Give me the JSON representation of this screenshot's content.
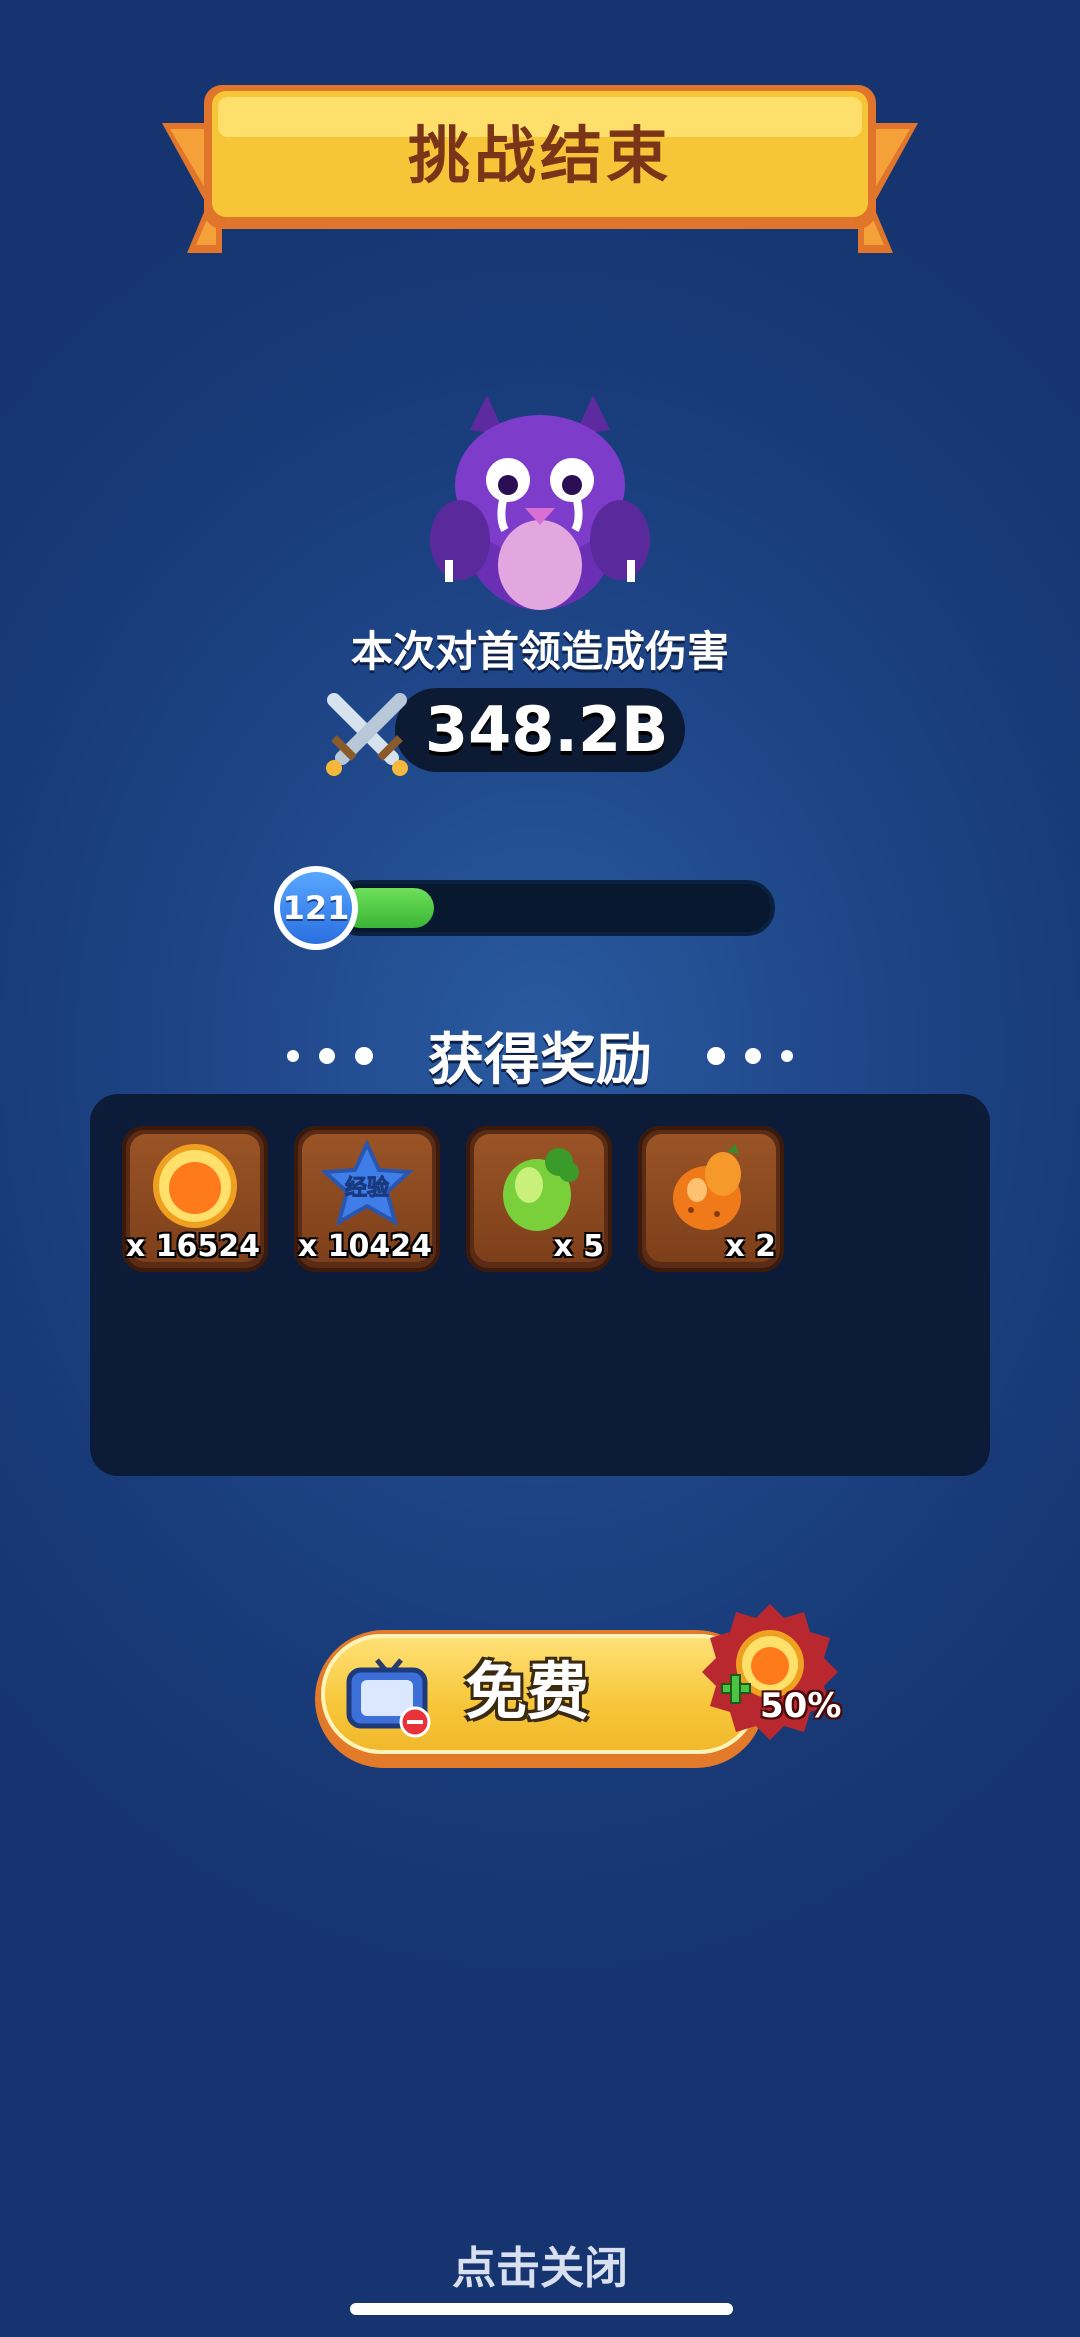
{
  "title": "挑战结束",
  "boss": {
    "damage_caption": "本次对首领造成伤害",
    "damage_value": "348.2B"
  },
  "progress": {
    "level": "121",
    "fill_fraction": 0.22
  },
  "rewards": {
    "title": "获得奖励",
    "items": [
      {
        "icon": "gold-coin-icon",
        "count": "x 16524"
      },
      {
        "icon": "experience-star-icon",
        "label": "经验",
        "count": "x 10424"
      },
      {
        "icon": "green-egg-icon",
        "count": "x 5"
      },
      {
        "icon": "orange-fruit-icon",
        "count": "x 2"
      }
    ]
  },
  "free_button": {
    "label": "免费",
    "bonus": "50%"
  },
  "close_hint": "点击关闭",
  "colors": {
    "background": "#1f4789",
    "banner": "#f7c638",
    "progress_fill": "#4cc443",
    "panel": "#0b1b38",
    "item_tile": "#8a4820"
  }
}
